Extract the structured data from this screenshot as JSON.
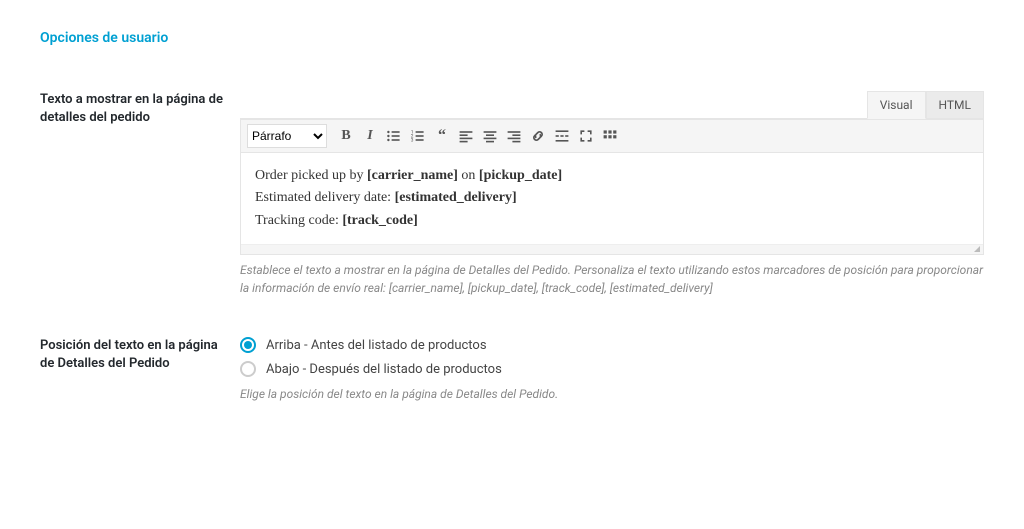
{
  "section_heading": "Opciones de usuario",
  "field_text": {
    "label": "Texto a mostrar en la página de detalles del pedido",
    "tabs": {
      "visual": "Visual",
      "html": "HTML"
    },
    "format_select": "Párrafo",
    "content": {
      "line1_a": "Order picked up by ",
      "line1_b": "[carrier_name]",
      "line1_c": " on ",
      "line1_d": "[pickup_date]",
      "line2_a": "Estimated delivery date: ",
      "line2_b": "[estimated_delivery]",
      "line3_a": "Tracking code: ",
      "line3_b": "[track_code]"
    },
    "description": "Establece el texto a mostrar en la página de Detalles del Pedido. Personaliza el texto utilizando estos marcadores de posición para proporcionar la información de envío real: [carrier_name], [pickup_date], [track_code], [estimated_delivery]"
  },
  "field_position": {
    "label": "Posición del texto en la página de Detalles del Pedido",
    "options": {
      "above": "Arriba - Antes del listado de productos",
      "below": "Abajo - Después del listado de productos"
    },
    "description": "Elige la posición del texto en la página de Detalles del Pedido."
  }
}
